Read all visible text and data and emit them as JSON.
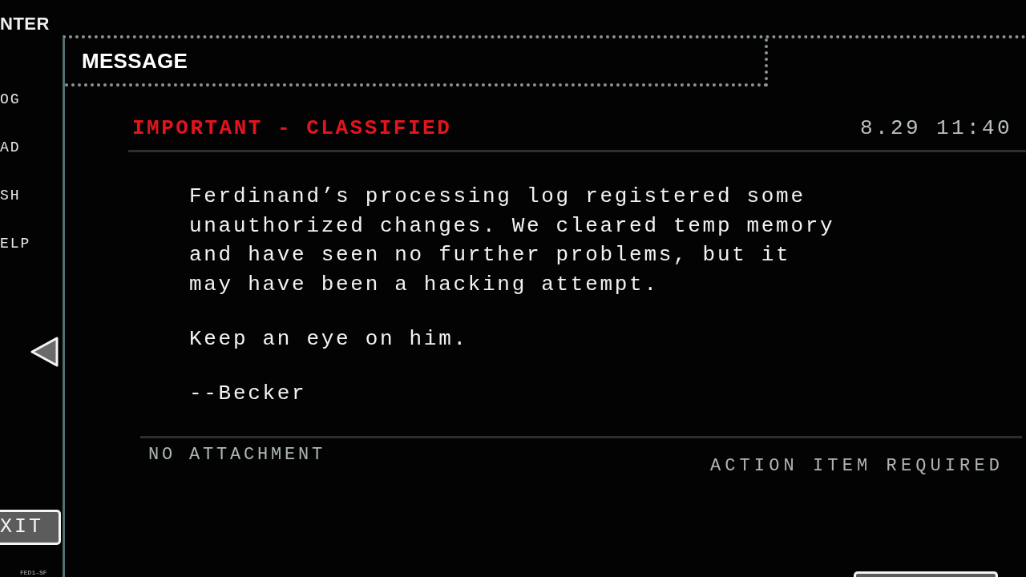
{
  "sidebar": {
    "title": "NTER",
    "items": [
      {
        "label": "OG"
      },
      {
        "label": "AD"
      },
      {
        "label": "SH"
      },
      {
        "label": "ELP"
      }
    ],
    "exit_button": "XIT",
    "footer_code": "FED1-SF"
  },
  "message": {
    "tab_title": "MESSAGE",
    "priority": "IMPORTANT - CLASSIFIED",
    "timestamp": "8.29 11:40",
    "body": [
      "Ferdinand’s processing log registered some unauthorized changes. We cleared temp memory and have seen no further problems, but it may have been a hacking attempt.",
      "Keep an eye on him.",
      "--Becker"
    ],
    "attachment": "NO ATTACHMENT",
    "action": "ACTION ITEM REQUIRED"
  }
}
